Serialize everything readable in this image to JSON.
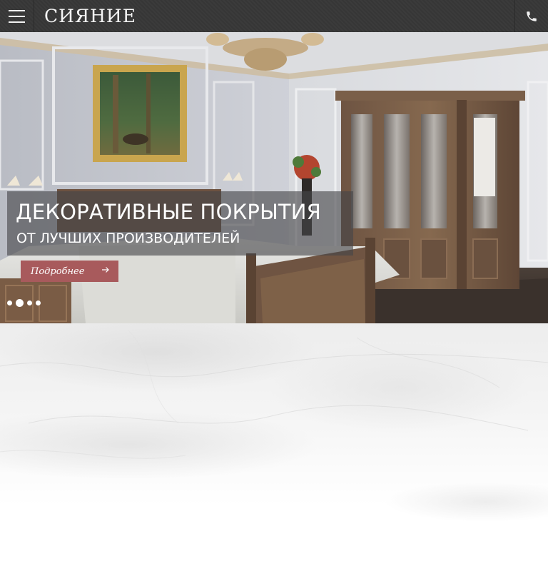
{
  "header": {
    "logo": "СИЯНИЕ",
    "menu_icon": "hamburger-menu-icon",
    "phone_icon": "phone-icon"
  },
  "hero": {
    "title": "ДЕКОРАТИВНЫЕ ПОКРЫТИЯ",
    "subtitle": "ОТ ЛУЧШИХ ПРОИЗВОДИТЕЛЕЙ",
    "button_label": "Подробнее",
    "button_icon": "arrow-right-icon",
    "slides_count": 4,
    "active_slide": 2
  },
  "colors": {
    "header_bg": "#3b3b3b",
    "accent": "#a85a5c",
    "caption_bg": "#464648"
  }
}
